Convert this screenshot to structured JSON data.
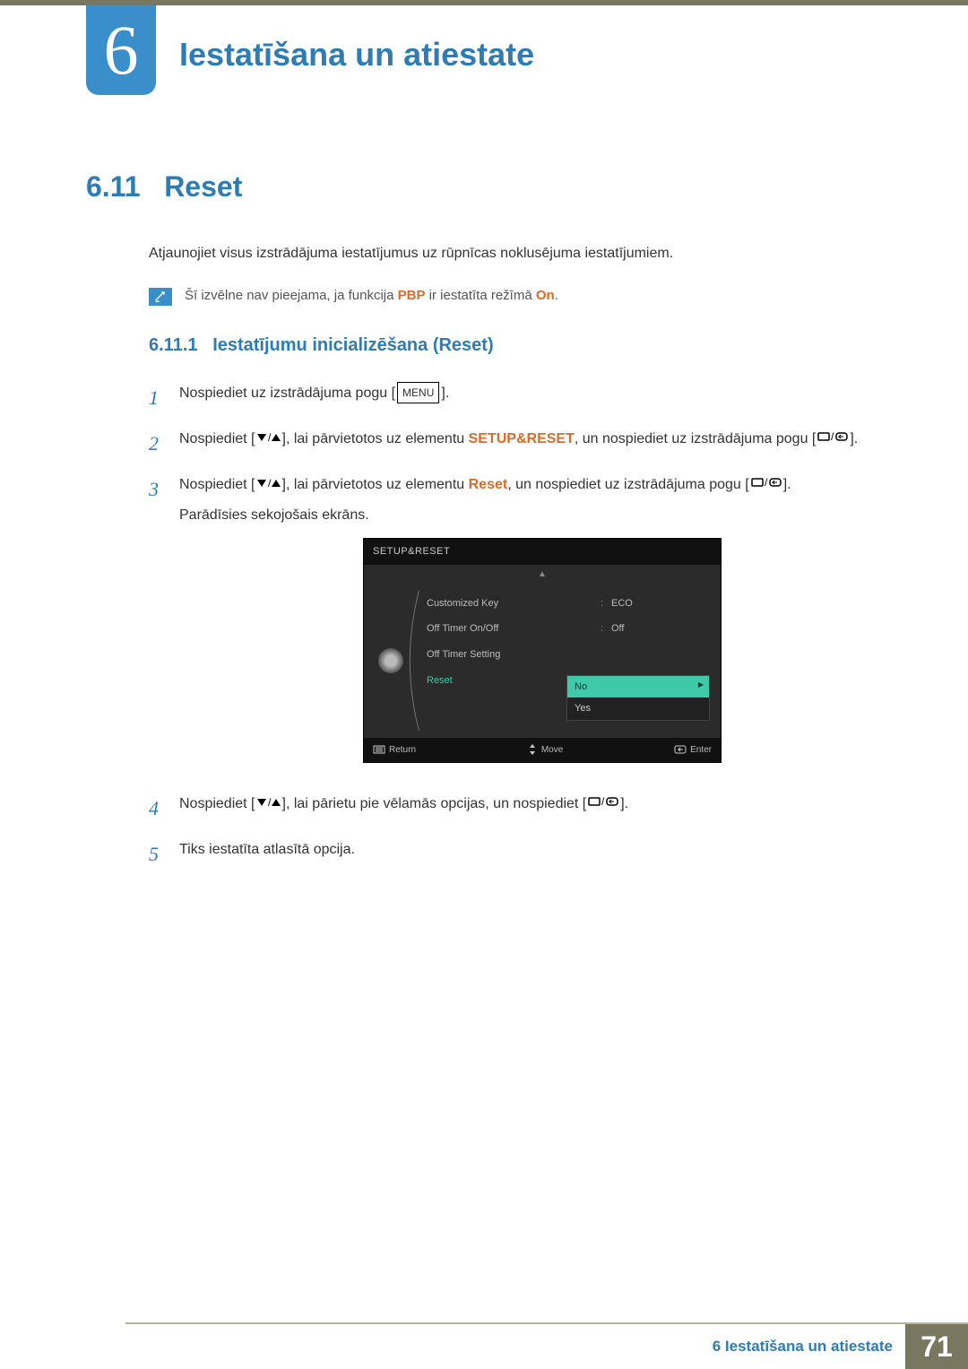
{
  "chapter": {
    "number": "6",
    "title": "Iestatīšana un atiestate"
  },
  "section": {
    "number": "6.11",
    "title": "Reset"
  },
  "intro": "Atjaunojiet visus izstrādājuma iestatījumus uz rūpnīcas noklusējuma iestatījumiem.",
  "note": {
    "pre": "Šī izvēlne nav pieejama, ja funkcija ",
    "pbp": "PBP",
    "mid": " ir iestatīta režīmā ",
    "on": "On",
    "post": "."
  },
  "subsection": {
    "number": "6.11.1",
    "title": "Iestatījumu inicializēšana (Reset)"
  },
  "steps": {
    "s1": {
      "num": "1",
      "pre": "Nospiediet uz izstrādājuma pogu [",
      "menu": "MENU",
      "post": "]."
    },
    "s2": {
      "num": "2",
      "pre": "Nospiediet [",
      "mid": "], lai pārvietotos uz elementu ",
      "kw": "SETUP&RESET",
      "after": ", un nospiediet uz izstrādājuma pogu [",
      "end": "]."
    },
    "s3": {
      "num": "3",
      "pre": "Nospiediet [",
      "mid": "], lai pārvietotos uz elementu ",
      "kw": "Reset",
      "after": ", un nospiediet uz izstrādājuma pogu [",
      "end": "].",
      "tail": "Parādīsies sekojošais ekrāns."
    },
    "s4": {
      "num": "4",
      "pre": "Nospiediet [",
      "mid": "], lai pārietu pie vēlamās opcijas, un nospiediet [",
      "end": "]."
    },
    "s5": {
      "num": "5",
      "text": "Tiks iestatīta atlasītā opcija."
    }
  },
  "osd": {
    "title": "SETUP&RESET",
    "rows": {
      "r1": {
        "label": "Customized Key",
        "val": "ECO"
      },
      "r2": {
        "label": "Off Timer On/Off",
        "val": "Off"
      },
      "r3": {
        "label": "Off Timer Setting",
        "val": ""
      },
      "r4": {
        "label": "Reset",
        "val": ""
      }
    },
    "popup": {
      "no": "No",
      "yes": "Yes"
    },
    "footer": {
      "return": "Return",
      "move": "Move",
      "enter": "Enter"
    }
  },
  "footer": {
    "label": "6 Iestatīšana un atiestate",
    "page": "71"
  }
}
